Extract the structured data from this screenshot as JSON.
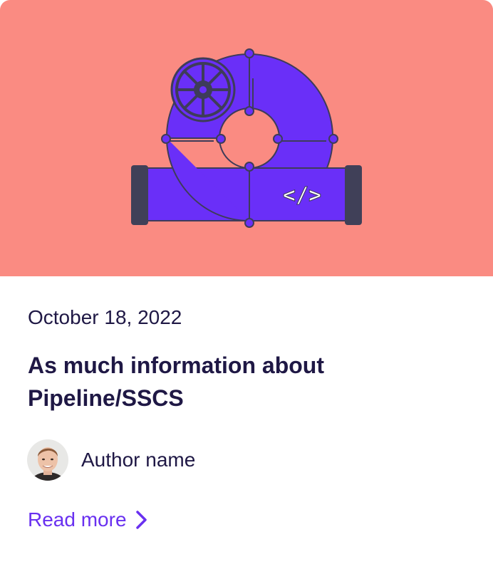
{
  "colors": {
    "hero_background": "#fa8b82",
    "pipe_fill": "#6a2ff8",
    "pipe_stroke": "#3e3c59",
    "text_primary": "#1f1845",
    "accent": "#6930f0"
  },
  "hero": {
    "illustration": "pipeline-valve-illustration",
    "code_glyph": "</>"
  },
  "post": {
    "date": "October 18, 2022",
    "title": "As much information about Pipeline/SSCS"
  },
  "author": {
    "name": "Author name",
    "avatar_icon": "author-photo"
  },
  "cta": {
    "label": "Read more",
    "icon": "chevron-right-icon"
  }
}
